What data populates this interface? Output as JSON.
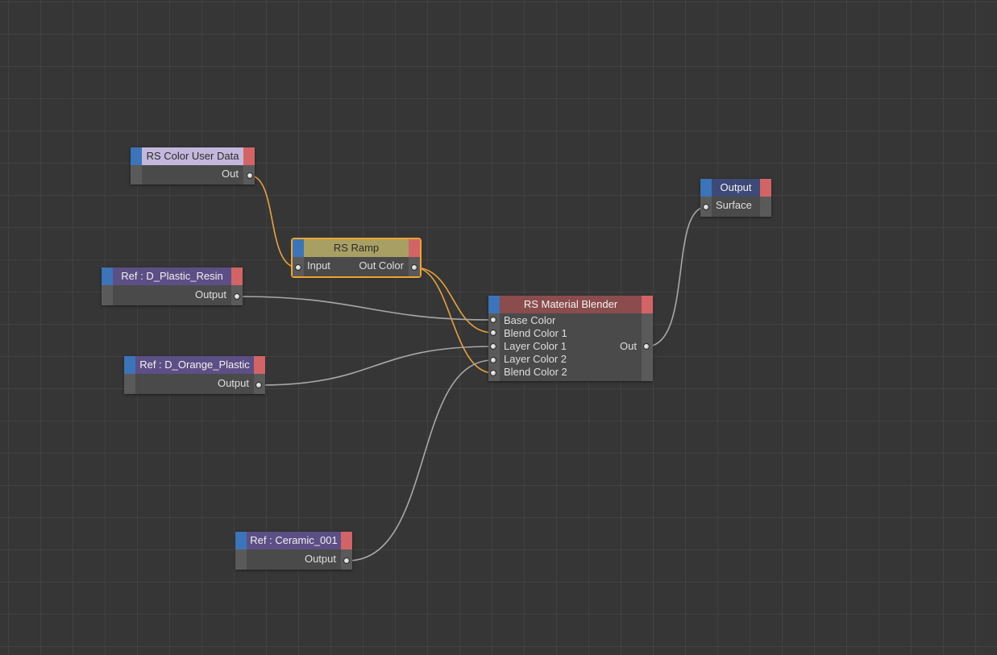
{
  "nodes": {
    "color_user_data": {
      "title": "RS Color User Data",
      "out": "Out"
    },
    "ramp": {
      "title": "RS Ramp",
      "in": "Input",
      "out": "Out Color"
    },
    "plastic_resin": {
      "title": "Ref : D_Plastic_Resin",
      "out": "Output"
    },
    "orange_plastic": {
      "title": "Ref : D_Orange_Plastic",
      "out": "Output"
    },
    "ceramic": {
      "title": "Ref : Ceramic_001",
      "out": "Output"
    },
    "blender": {
      "title": "RS Material Blender",
      "inputs": [
        "Base Color",
        "Blend Color 1",
        "Layer Color 1",
        "Layer Color 2",
        "Blend Color 2"
      ],
      "out": "Out"
    },
    "output": {
      "title": "Output",
      "in": "Surface"
    }
  },
  "colors": {
    "background": "#363636",
    "input_strip": "#3b74b8",
    "output_strip": "#d26466",
    "selected_wire": "#e8a23a",
    "wire": "#a8a8a8",
    "user_data_header": "#c3b8dc",
    "ramp_header": "#a89f63",
    "ref_header": "#5c4f85",
    "blender_header": "#8a4c4c",
    "output_header": "#3d4a78"
  }
}
